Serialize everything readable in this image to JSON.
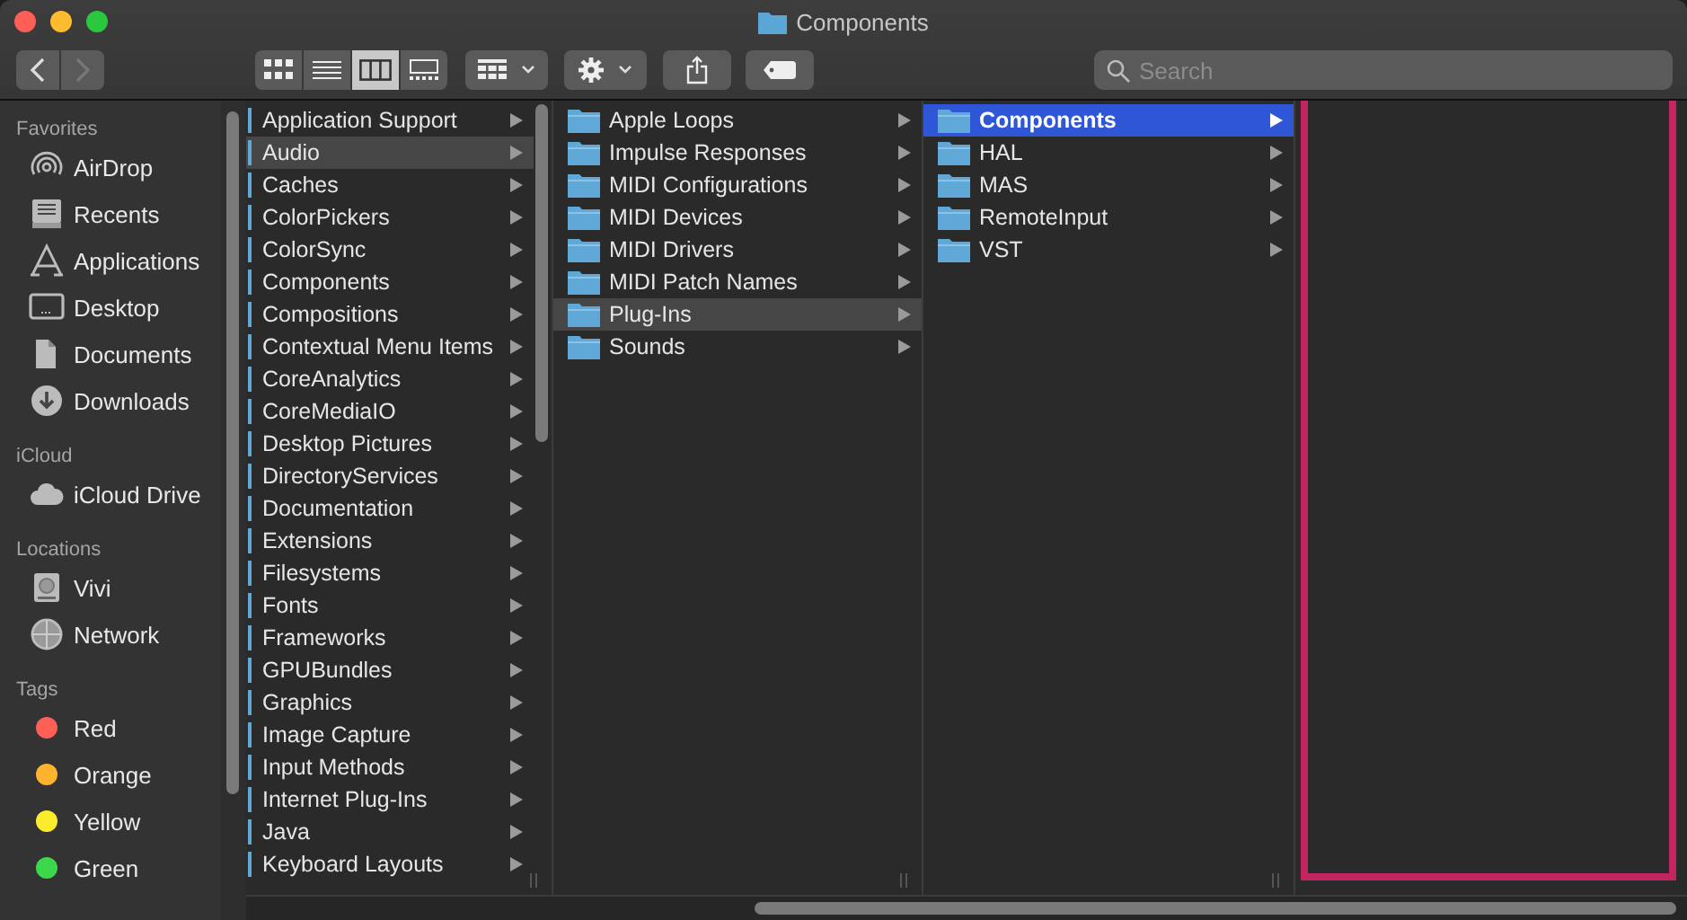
{
  "window": {
    "title": "Components"
  },
  "view_modes": [
    {
      "kind": "icons",
      "selected": false
    },
    {
      "kind": "list",
      "selected": false
    },
    {
      "kind": "columns",
      "selected": true
    },
    {
      "kind": "gallery",
      "selected": false
    }
  ],
  "search": {
    "placeholder": "Search"
  },
  "sidebar": [
    {
      "heading": "Favorites",
      "items": [
        {
          "label": "AirDrop",
          "kind": "airdrop"
        },
        {
          "label": "Recents",
          "kind": "recents"
        },
        {
          "label": "Applications",
          "kind": "applications"
        },
        {
          "label": "Desktop",
          "kind": "desktop"
        },
        {
          "label": "Documents",
          "kind": "documents"
        },
        {
          "label": "Downloads",
          "kind": "downloads"
        }
      ]
    },
    {
      "heading": "iCloud",
      "items": [
        {
          "label": "iCloud Drive",
          "kind": "cloud"
        }
      ]
    },
    {
      "heading": "Locations",
      "items": [
        {
          "label": "Vivi",
          "kind": "disk"
        },
        {
          "label": "Network",
          "kind": "network"
        }
      ]
    },
    {
      "heading": "Tags",
      "items": [
        {
          "label": "Red",
          "kind": "tag",
          "color": "#fe5f57"
        },
        {
          "label": "Orange",
          "kind": "tag",
          "color": "#fdb32e"
        },
        {
          "label": "Yellow",
          "kind": "tag",
          "color": "#fdeb2e"
        },
        {
          "label": "Green",
          "kind": "tag",
          "color": "#3cd84b"
        }
      ]
    }
  ],
  "columns": [
    {
      "kind": "clipped",
      "items": [
        {
          "label": "Application Support",
          "selected": false
        },
        {
          "label": "Audio",
          "selected": true
        },
        {
          "label": "Caches",
          "selected": false
        },
        {
          "label": "ColorPickers",
          "selected": false
        },
        {
          "label": "ColorSync",
          "selected": false
        },
        {
          "label": "Components",
          "selected": false
        },
        {
          "label": "Compositions",
          "selected": false
        },
        {
          "label": "Contextual Menu Items",
          "selected": false
        },
        {
          "label": "CoreAnalytics",
          "selected": false
        },
        {
          "label": "CoreMediaIO",
          "selected": false
        },
        {
          "label": "Desktop Pictures",
          "selected": false
        },
        {
          "label": "DirectoryServices",
          "selected": false
        },
        {
          "label": "Documentation",
          "selected": false
        },
        {
          "label": "Extensions",
          "selected": false
        },
        {
          "label": "Filesystems",
          "selected": false
        },
        {
          "label": "Fonts",
          "selected": false
        },
        {
          "label": "Frameworks",
          "selected": false
        },
        {
          "label": "GPUBundles",
          "selected": false
        },
        {
          "label": "Graphics",
          "selected": false
        },
        {
          "label": "Image Capture",
          "selected": false
        },
        {
          "label": "Input Methods",
          "selected": false
        },
        {
          "label": "Internet Plug-Ins",
          "selected": false
        },
        {
          "label": "Java",
          "selected": false
        },
        {
          "label": "Keyboard Layouts",
          "selected": false
        }
      ]
    },
    {
      "kind": "full",
      "items": [
        {
          "label": "Apple Loops",
          "selected": false
        },
        {
          "label": "Impulse Responses",
          "selected": false
        },
        {
          "label": "MIDI Configurations",
          "selected": false
        },
        {
          "label": "MIDI Devices",
          "selected": false
        },
        {
          "label": "MIDI Drivers",
          "selected": false
        },
        {
          "label": "MIDI Patch Names",
          "selected": false
        },
        {
          "label": "Plug-Ins",
          "selected": true
        },
        {
          "label": "Sounds",
          "selected": false
        }
      ]
    },
    {
      "kind": "full",
      "focused": true,
      "items": [
        {
          "label": "Components",
          "selected": true
        },
        {
          "label": "HAL",
          "selected": false
        },
        {
          "label": "MAS",
          "selected": false
        },
        {
          "label": "RemoteInput",
          "selected": false
        },
        {
          "label": "VST",
          "selected": false
        }
      ]
    }
  ]
}
